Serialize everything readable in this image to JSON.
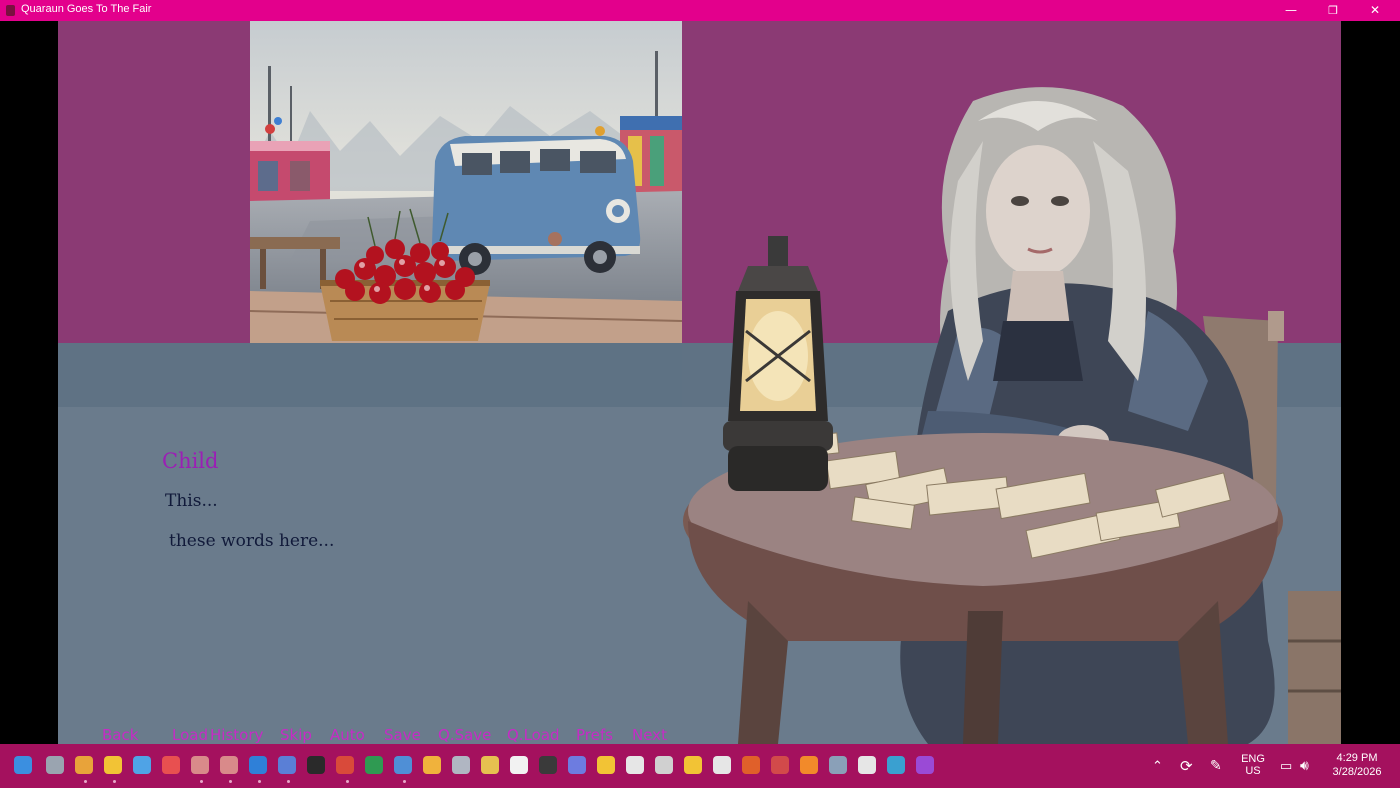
{
  "window": {
    "title": "Quaraun Goes To The Fair",
    "controls": {
      "minimize": "—",
      "maximize": "❐",
      "close": "✕"
    }
  },
  "dialogue": {
    "speaker": "Child",
    "line1": "This...",
    "line2": "these words here..."
  },
  "quick_menu": [
    "Back",
    "Load",
    "History",
    "Skip",
    "Auto",
    "Save",
    "Q.Save",
    "Q.Load",
    "Prefs",
    "Next"
  ],
  "colors": {
    "titlebar": "#e3008c",
    "background_top": "#8b3a74",
    "background_lower": "#6a7b8c",
    "speaker": "#9b1fb5",
    "quick_menu": "#c62bc6",
    "taskbar": "#a4115e"
  },
  "taskbar": {
    "icons": [
      "start-icon",
      "task-view-icon",
      "chrome-icon",
      "chrome-alt-icon",
      "mail-icon",
      "pocket-icon",
      "game-char-icon",
      "game-char-active-icon",
      "vscode-icon",
      "notepad-icon",
      "terminal-icon",
      "gmail-icon",
      "sheets-icon",
      "photos-icon",
      "pencil-icon",
      "discord-icon",
      "smiley-icon",
      "clipboard-icon",
      "console-icon",
      "copilot-icon",
      "files-icon",
      "document-icon",
      "openai-icon",
      "wave-icon",
      "screenshot-icon",
      "ubuntu-icon",
      "crab-icon",
      "blender-icon",
      "settings-icon",
      "media-player-icon",
      "map-icon",
      "clapper-icon"
    ],
    "tray": {
      "language_top": "ENG",
      "language_bottom": "US",
      "time": "4:29 PM",
      "date": "3/28/2026"
    }
  }
}
